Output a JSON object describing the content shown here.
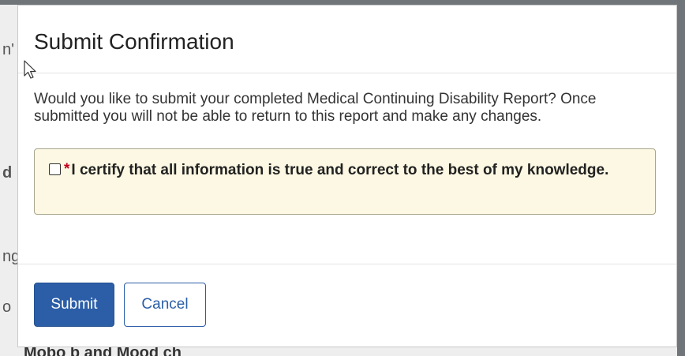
{
  "background": {
    "fragments": [
      "n'",
      "d",
      "ng",
      "o"
    ],
    "bottom_text": "Mobo  b  and Mood  ch"
  },
  "modal": {
    "title": "Submit Confirmation",
    "body_text": "Would you like to submit your completed Medical Continuing Disability Report? Once submitted you will not be able to return to this report and make any changes.",
    "certification": {
      "required_marker": "*",
      "label": "I certify that all information is true and correct to the best of my knowledge.",
      "checked": false
    },
    "buttons": {
      "submit": "Submit",
      "cancel": "Cancel"
    }
  },
  "colors": {
    "primary": "#2b5ea7",
    "warning_bg": "#fcf8e3",
    "required": "#c0001a"
  },
  "icons": {
    "cursor": "mouse-pointer-icon"
  }
}
